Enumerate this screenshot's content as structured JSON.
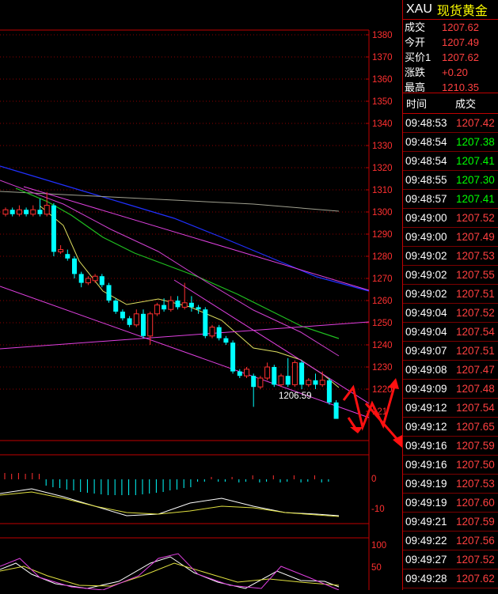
{
  "header": {
    "symbol": "XAU",
    "name": "现货黄金"
  },
  "quote": [
    {
      "label": "成交",
      "value": "1207.62"
    },
    {
      "label": "今开",
      "value": "1207.49"
    },
    {
      "label": "买价1",
      "value": "1207.62"
    },
    {
      "label": "涨跌",
      "value": "+0.20"
    },
    {
      "label": "最高",
      "value": "1210.35"
    }
  ],
  "ticks_header": {
    "time": "时间",
    "price": "成交"
  },
  "ticks": [
    {
      "time": "09:48:53",
      "price": "1207.42",
      "dir": "up"
    },
    {
      "time": "09:48:54",
      "price": "1207.38",
      "dir": "down"
    },
    {
      "time": "09:48:54",
      "price": "1207.41",
      "dir": "down"
    },
    {
      "time": "09:48:55",
      "price": "1207.30",
      "dir": "down"
    },
    {
      "time": "09:48:57",
      "price": "1207.41",
      "dir": "down"
    },
    {
      "time": "09:49:00",
      "price": "1207.52",
      "dir": "up"
    },
    {
      "time": "09:49:00",
      "price": "1207.49",
      "dir": "up"
    },
    {
      "time": "09:49:02",
      "price": "1207.53",
      "dir": "up"
    },
    {
      "time": "09:49:02",
      "price": "1207.55",
      "dir": "up"
    },
    {
      "time": "09:49:02",
      "price": "1207.51",
      "dir": "up"
    },
    {
      "time": "09:49:04",
      "price": "1207.52",
      "dir": "up"
    },
    {
      "time": "09:49:04",
      "price": "1207.54",
      "dir": "up"
    },
    {
      "time": "09:49:07",
      "price": "1207.51",
      "dir": "up"
    },
    {
      "time": "09:49:08",
      "price": "1207.47",
      "dir": "up"
    },
    {
      "time": "09:49:09",
      "price": "1207.48",
      "dir": "up"
    },
    {
      "time": "09:49:12",
      "price": "1207.54",
      "dir": "up"
    },
    {
      "time": "09:49:12",
      "price": "1207.65",
      "dir": "up"
    },
    {
      "time": "09:49:16",
      "price": "1207.59",
      "dir": "up"
    },
    {
      "time": "09:49:16",
      "price": "1207.50",
      "dir": "up"
    },
    {
      "time": "09:49:19",
      "price": "1207.53",
      "dir": "up"
    },
    {
      "time": "09:49:19",
      "price": "1207.60",
      "dir": "up"
    },
    {
      "time": "09:49:21",
      "price": "1207.59",
      "dir": "up"
    },
    {
      "time": "09:49:22",
      "price": "1207.56",
      "dir": "up"
    },
    {
      "time": "09:49:27",
      "price": "1207.52",
      "dir": "up"
    },
    {
      "time": "09:49:28",
      "price": "1207.62",
      "dir": "up"
    }
  ],
  "chart_data": {
    "type": "candlestick",
    "y_axis_labels": [
      "1380",
      "1370",
      "1360",
      "1350",
      "1340",
      "1330",
      "1320",
      "1310",
      "1300",
      "1290",
      "1280",
      "1270",
      "1260",
      "1250",
      "1240",
      "1230",
      "1220",
      "121"
    ],
    "low_label": "1206.59",
    "macd_axis_labels": [
      "0",
      "-10"
    ],
    "kdj_axis_labels": [
      "100",
      "50"
    ],
    "colors": {
      "up": "#ff3030",
      "down": "#00ffff",
      "grid": "#8b0000",
      "axis": "#c00000"
    },
    "candles": [
      {
        "o": 1299,
        "c": 1301,
        "h": 1302,
        "l": 1298
      },
      {
        "o": 1301,
        "c": 1299,
        "h": 1302,
        "l": 1298
      },
      {
        "o": 1299,
        "c": 1301,
        "h": 1303,
        "l": 1298
      },
      {
        "o": 1301,
        "c": 1299,
        "h": 1302,
        "l": 1298
      },
      {
        "o": 1299,
        "c": 1301,
        "h": 1303,
        "l": 1298
      },
      {
        "o": 1301,
        "c": 1299,
        "h": 1306,
        "l": 1298
      },
      {
        "o": 1299,
        "c": 1303,
        "h": 1309,
        "l": 1298
      },
      {
        "o": 1303,
        "c": 1282,
        "h": 1304,
        "l": 1280
      },
      {
        "o": 1282,
        "c": 1283,
        "h": 1285,
        "l": 1281
      },
      {
        "o": 1281,
        "c": 1279,
        "h": 1283,
        "l": 1278
      },
      {
        "o": 1279,
        "c": 1272,
        "h": 1280,
        "l": 1270
      },
      {
        "o": 1272,
        "c": 1268,
        "h": 1273,
        "l": 1266
      },
      {
        "o": 1268,
        "c": 1270,
        "h": 1271,
        "l": 1267
      },
      {
        "o": 1269,
        "c": 1271,
        "h": 1272,
        "l": 1268
      },
      {
        "o": 1271,
        "c": 1267,
        "h": 1272,
        "l": 1266
      },
      {
        "o": 1267,
        "c": 1260,
        "h": 1268,
        "l": 1259
      },
      {
        "o": 1260,
        "c": 1255,
        "h": 1261,
        "l": 1254
      },
      {
        "o": 1255,
        "c": 1252,
        "h": 1256,
        "l": 1251
      },
      {
        "o": 1252,
        "c": 1249,
        "h": 1253,
        "l": 1248
      },
      {
        "o": 1249,
        "c": 1254,
        "h": 1256,
        "l": 1248
      },
      {
        "o": 1254,
        "c": 1244,
        "h": 1256,
        "l": 1243
      },
      {
        "o": 1244,
        "c": 1254,
        "h": 1255,
        "l": 1240
      },
      {
        "o": 1254,
        "c": 1258,
        "h": 1259,
        "l": 1253
      },
      {
        "o": 1258,
        "c": 1256,
        "h": 1261,
        "l": 1255
      },
      {
        "o": 1256,
        "c": 1260,
        "h": 1262,
        "l": 1255
      },
      {
        "o": 1260,
        "c": 1257,
        "h": 1262,
        "l": 1256
      },
      {
        "o": 1257,
        "c": 1259,
        "h": 1268,
        "l": 1256
      },
      {
        "o": 1259,
        "c": 1257,
        "h": 1262,
        "l": 1255
      },
      {
        "o": 1257,
        "c": 1256,
        "h": 1258,
        "l": 1254
      },
      {
        "o": 1256,
        "c": 1244,
        "h": 1257,
        "l": 1243
      },
      {
        "o": 1244,
        "c": 1248,
        "h": 1249,
        "l": 1243
      },
      {
        "o": 1248,
        "c": 1243,
        "h": 1249,
        "l": 1242
      },
      {
        "o": 1243,
        "c": 1241,
        "h": 1244,
        "l": 1240
      },
      {
        "o": 1241,
        "c": 1228,
        "h": 1242,
        "l": 1227
      },
      {
        "o": 1228,
        "c": 1226,
        "h": 1229,
        "l": 1225
      },
      {
        "o": 1226,
        "c": 1229,
        "h": 1230,
        "l": 1225
      },
      {
        "o": 1226,
        "c": 1221,
        "h": 1227,
        "l": 1212
      },
      {
        "o": 1221,
        "c": 1225,
        "h": 1226,
        "l": 1220
      },
      {
        "o": 1225,
        "c": 1230,
        "h": 1232,
        "l": 1224
      },
      {
        "o": 1230,
        "c": 1222,
        "h": 1231,
        "l": 1221
      },
      {
        "o": 1222,
        "c": 1226,
        "h": 1227,
        "l": 1221
      },
      {
        "o": 1226,
        "c": 1222,
        "h": 1234,
        "l": 1221
      },
      {
        "o": 1222,
        "c": 1232,
        "h": 1233,
        "l": 1221
      },
      {
        "o": 1232,
        "c": 1222,
        "h": 1233,
        "l": 1220
      },
      {
        "o": 1222,
        "c": 1224,
        "h": 1225,
        "l": 1221
      },
      {
        "o": 1224,
        "c": 1222,
        "h": 1227,
        "l": 1220
      },
      {
        "o": 1222,
        "c": 1224,
        "h": 1228,
        "l": 1221
      },
      {
        "o": 1224,
        "c": 1214,
        "h": 1225,
        "l": 1213
      },
      {
        "o": 1214,
        "c": 1206.59,
        "h": 1215,
        "l": 1206.59
      }
    ]
  }
}
